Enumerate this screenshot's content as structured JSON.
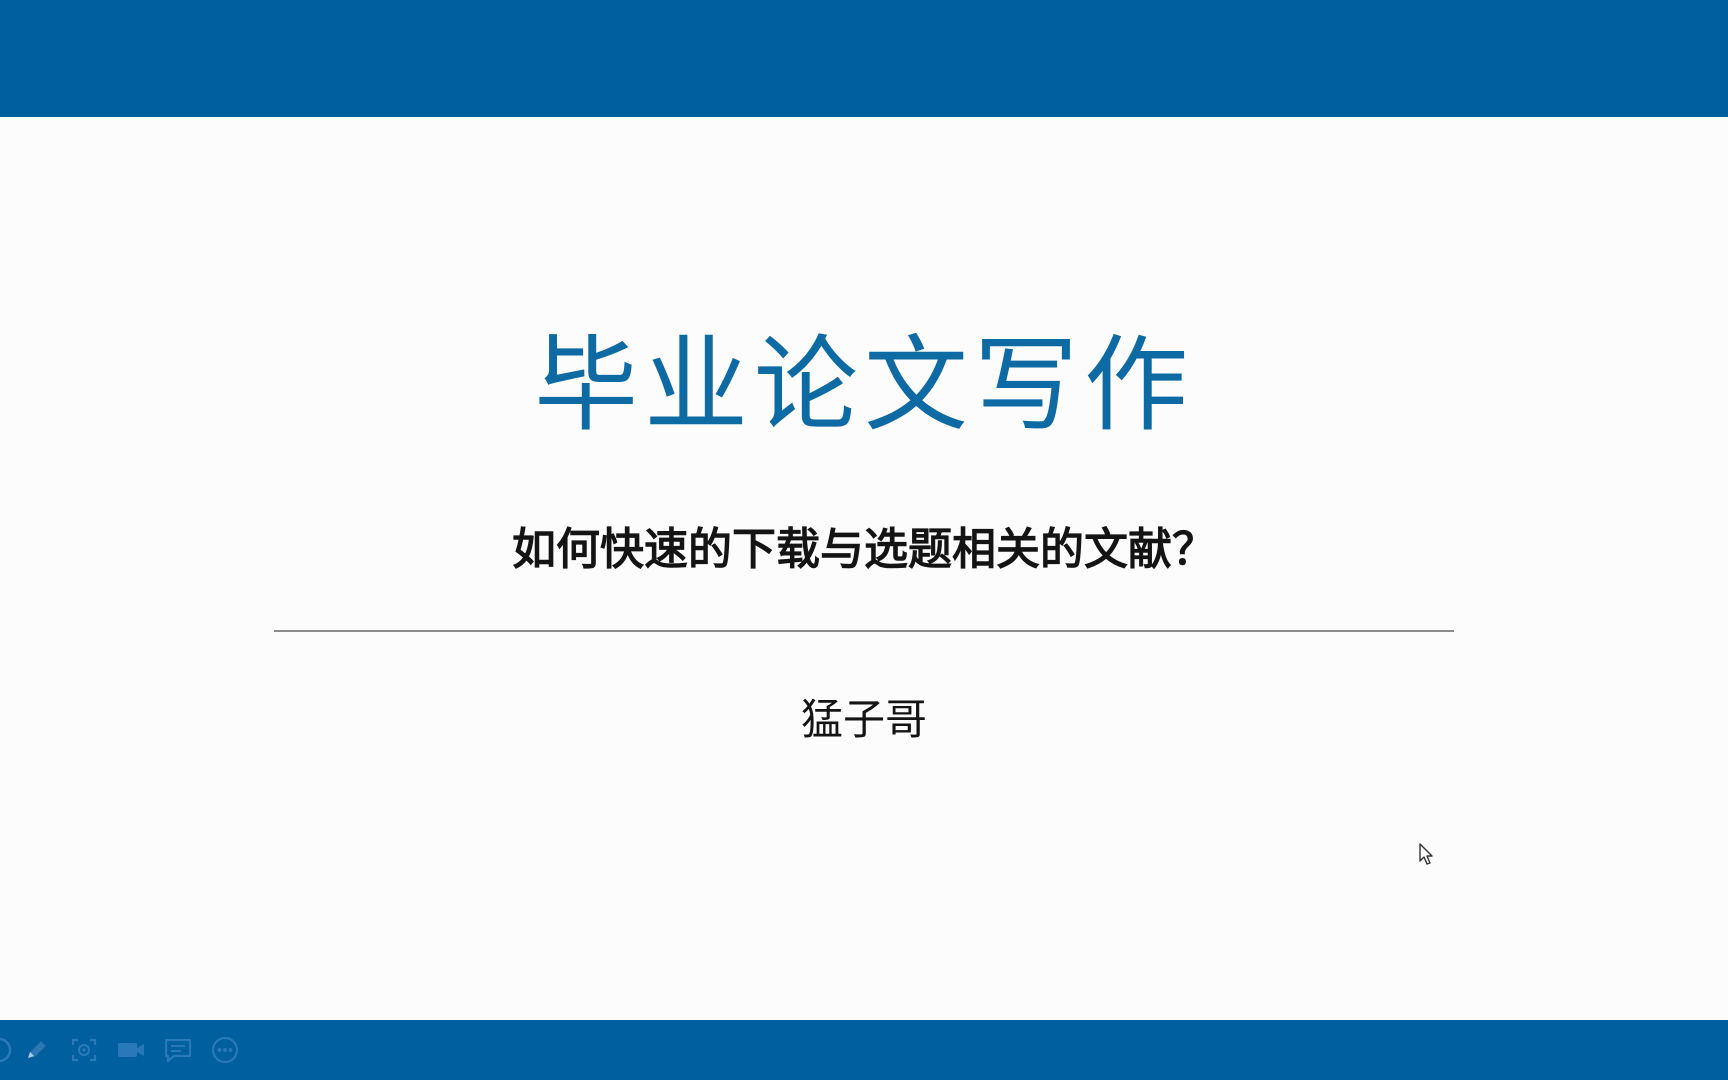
{
  "slide": {
    "title": "毕业论文写作",
    "subtitle": "如何快速的下载与选题相关的文献？",
    "author": "猛子哥"
  },
  "colors": {
    "header_bar": "#005f9e",
    "footer_bar": "#005f9e",
    "title": "#0d6aa3",
    "text": "#141414",
    "divider": "#8c8c8c"
  },
  "toolbar": {
    "icons": [
      "circle-icon",
      "pen-icon",
      "screenshot-icon",
      "video-camera-icon",
      "comment-icon",
      "more-icon"
    ]
  }
}
